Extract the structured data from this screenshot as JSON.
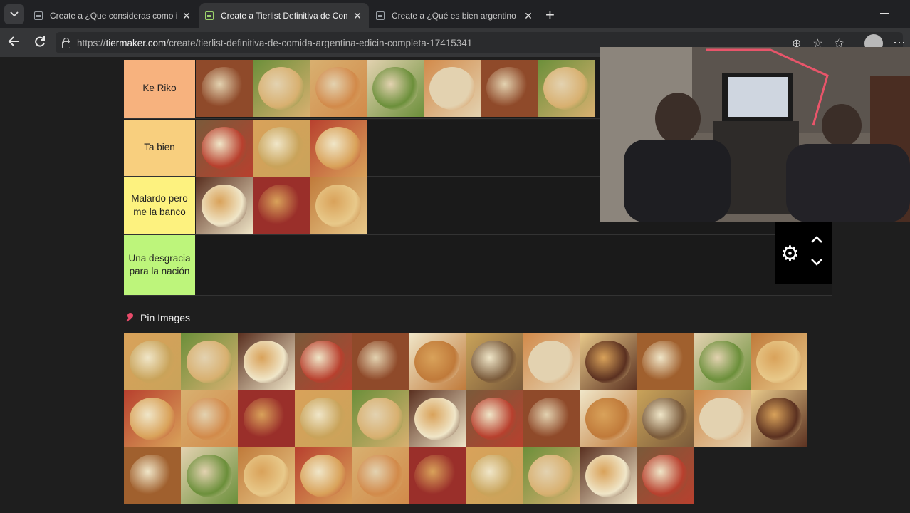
{
  "browser": {
    "tabs": [
      {
        "title": "Create a ¿Que consideras como im",
        "active": false
      },
      {
        "title": "Create a Tierlist Definitiva de Com",
        "active": true
      },
      {
        "title": "Create a ¿Qué es bien argentino y",
        "active": false
      }
    ],
    "url_prefix": "https://",
    "url_domain": "tiermaker.com",
    "url_path": "/create/tierlist-definitiva-de-comida-argentina-edicin-completa-17415341",
    "icons": [
      "back-arrow-icon",
      "reload-icon",
      "lock-icon",
      "extensions-icon",
      "star-icon",
      "favorites-icon",
      "profile-avatar",
      "more-icon"
    ]
  },
  "tiers": [
    {
      "label": "Ke Riko",
      "color": "#f7b27e",
      "item_count": 7
    },
    {
      "label": "Ta bien",
      "color": "#f8cf7e",
      "item_count": 3
    },
    {
      "label": "Malardo pero me la banco",
      "color": "#fdf27f",
      "item_count": 3
    },
    {
      "label": "Una desgracia para la nación",
      "color": "#bdf57b",
      "item_count": 0
    }
  ],
  "pool": {
    "heading": "Pin Images",
    "item_count": 34
  },
  "palette": [
    "#c07a3a",
    "#d9a25a",
    "#8f4a2a",
    "#e8c98a",
    "#b8402e",
    "#6b8f3a",
    "#f0e6c8",
    "#a0602e",
    "#d8b070",
    "#5a3020",
    "#c9a35a",
    "#e3d2b0",
    "#9a2f2a",
    "#7a5a3a",
    "#d28a4a"
  ]
}
